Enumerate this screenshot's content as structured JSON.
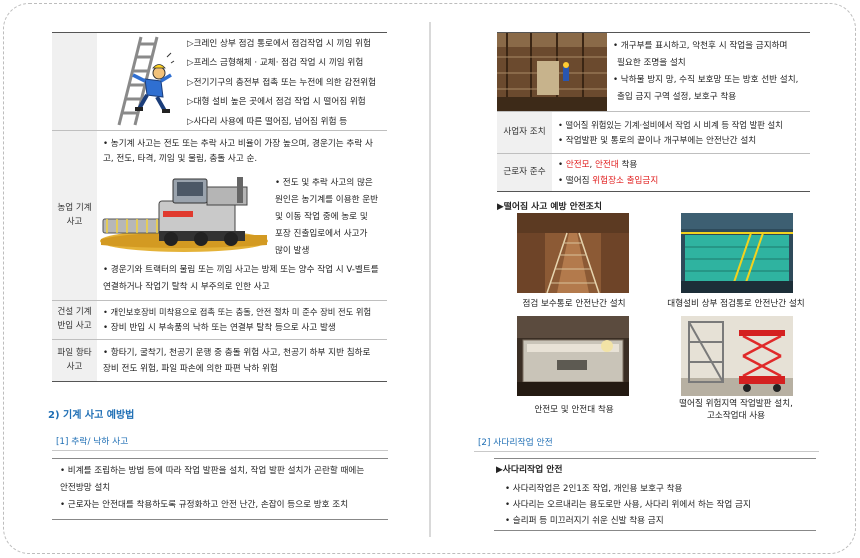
{
  "left": {
    "rows": [
      {
        "header": "",
        "lines": [
          "▷크레인 상부 점검 통로에서 점검작업 시 끼임 위험",
          "▷프레스 금형해체 · 교체· 점검 작업 시 끼임 위험",
          "▷전기기구의 충전부 접촉 또는 누전에 의한 감전위험",
          "▷대형 설비 높은 곳에서 점검 작업 시 떨어짐 위험",
          "▷사다리 사용에 따른 떨어짐, 넘어짐 위험 등"
        ]
      },
      {
        "header": "농업 기계 사고",
        "intro_1": "• 농기계 사고는 전도 또는 추락 사고 비율이 가장 높으며, 경운기는 추락 사",
        "intro_2": "고, 전도, 타격, 끼임 및 물림, 충돌 사고 순.",
        "side_lines": [
          "• 전도 및 추락 사고의 많은",
          "원인은 농기계를 이용한 운반",
          "및 이동 작업 중에 농로 및",
          "포장  진출입로에서  사고가",
          "많이 발생"
        ],
        "foot_1": "• 경운기와 트랙터의 물림 또는 끼임 사고는 방제 또는 양수 작업 시 V-벨트를",
        "foot_2": "연결하거나 작업기 탈착 시 부주의로 인한 사고"
      },
      {
        "header": "건설 기계 반입 사고",
        "lines": [
          "• 개인보호장비 미착용으로 접촉 또는 충돌, 안전 절차 미 준수 장비 전도 위험",
          "• 장비 반입 시 부속품의 낙하 또는 연결부 탈착 등으로 사고 발생"
        ]
      },
      {
        "header": "파일 항타 사고",
        "lines": [
          "• 항타기, 굴착기, 천공기 운행 중 충돌 위험 사고, 천공기 하부 지반 침하로",
          "장비 전도 위험, 파일 파손에 의한 파편 낙하 위험"
        ]
      }
    ],
    "section_title": "2) 기계 사고 예방법",
    "subsection": "[1] 추락/ 낙하 사고",
    "box_lines": [
      "• 비계를 조립하는 방법 등에 따라 작업 발판을 설치, 작업 발판 설치가 곤란할 때에는",
      "안전방망 설치",
      "• 근로자는 안전대를 착용하도록 규정화하고 안전 난간, 손잡이 등으로 방호 조치"
    ]
  },
  "right": {
    "top_lines": [
      "• 개구부를 표시하고, 악천후 시 작업을 금지하며",
      "필요한 조명을 설치",
      "• 낙하물 방지 망, 수직 보호망 또는 방호 선반 설치,",
      "출입 금지 구역 설정, 보호구 착용"
    ],
    "employer": {
      "header": "사업자 조치",
      "lines": [
        "• 떨어질 위험있는 기계·설비에서 작업 시 비계 등 작업 발판 설치",
        "• 작업발판 및 통로의 끝이나 개구부에는 안전난간 설치"
      ]
    },
    "worker": {
      "header": "근로자 준수",
      "l1_pre": "• ",
      "l1_red1": "안전모",
      "l1_sep": ", ",
      "l1_red2": "안전대",
      "l1_post": " 착용",
      "l2_pre": "• 떨어짐 ",
      "l2_red": "위험장소 출입금지",
      "l2_post": ""
    },
    "photos_title": "▶떨어짐 사고 예방 안전조치",
    "captions": [
      "점검 보수통로 안전난간 설치",
      "대형설비 상부 점검통로 안전난간 설치",
      "안전모 및 안전대 착용",
      "떨어질 위험지역 작업발판 설치,",
      "고소작업대 사용"
    ],
    "subsection": "[2] 사다리작업 안전",
    "ladder_title": "▶사다리작업 안전",
    "ladder_lines": [
      "• 사다리작업은 2인1조 작업, 개인용 보호구 착용",
      "• 사다리는 오르내리는 용도로만 사용, 사다리 위에서 하는 작업 금지",
      "• 슬리퍼 등 미끄러지기 쉬운 신발 착용 금지"
    ]
  },
  "colors": {
    "accent": "#1f6fb5",
    "warning": "#e01b1b"
  }
}
